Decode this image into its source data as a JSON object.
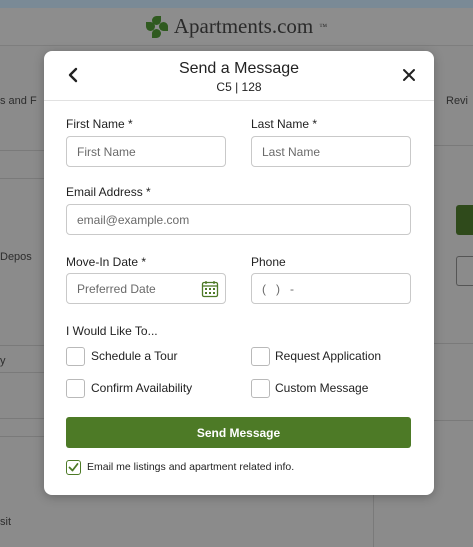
{
  "background": {
    "logo_text": "Apartments.com",
    "logo_tm": "™",
    "fragments": [
      "s and F",
      "Revi",
      "Depos",
      "y",
      "sit"
    ]
  },
  "modal": {
    "title": "Send a Message",
    "subtitle": "C5 | 128",
    "back_icon": "chevron-left-icon",
    "close_icon": "close-icon"
  },
  "form": {
    "first_name": {
      "label": "First Name *",
      "placeholder": "First Name",
      "value": ""
    },
    "last_name": {
      "label": "Last Name *",
      "placeholder": "Last Name",
      "value": ""
    },
    "email": {
      "label": "Email Address *",
      "placeholder": "email@example.com",
      "value": ""
    },
    "move_in": {
      "label": "Move-In Date *",
      "placeholder": "Preferred Date",
      "value": "",
      "icon": "calendar-icon"
    },
    "phone": {
      "label": "Phone",
      "placeholder": "(   )   -",
      "value": ""
    }
  },
  "interests": {
    "heading": "I Would Like To...",
    "options": [
      {
        "label": "Schedule a Tour",
        "checked": false
      },
      {
        "label": "Request Application",
        "checked": false
      },
      {
        "label": "Confirm Availability",
        "checked": false
      },
      {
        "label": "Custom Message",
        "checked": false
      }
    ]
  },
  "submit": {
    "label": "Send Message"
  },
  "opt_in": {
    "label": "Email me listings and apartment related info.",
    "checked": true
  },
  "colors": {
    "accent": "#4d7a26",
    "overlay": "#8b8b8b"
  }
}
